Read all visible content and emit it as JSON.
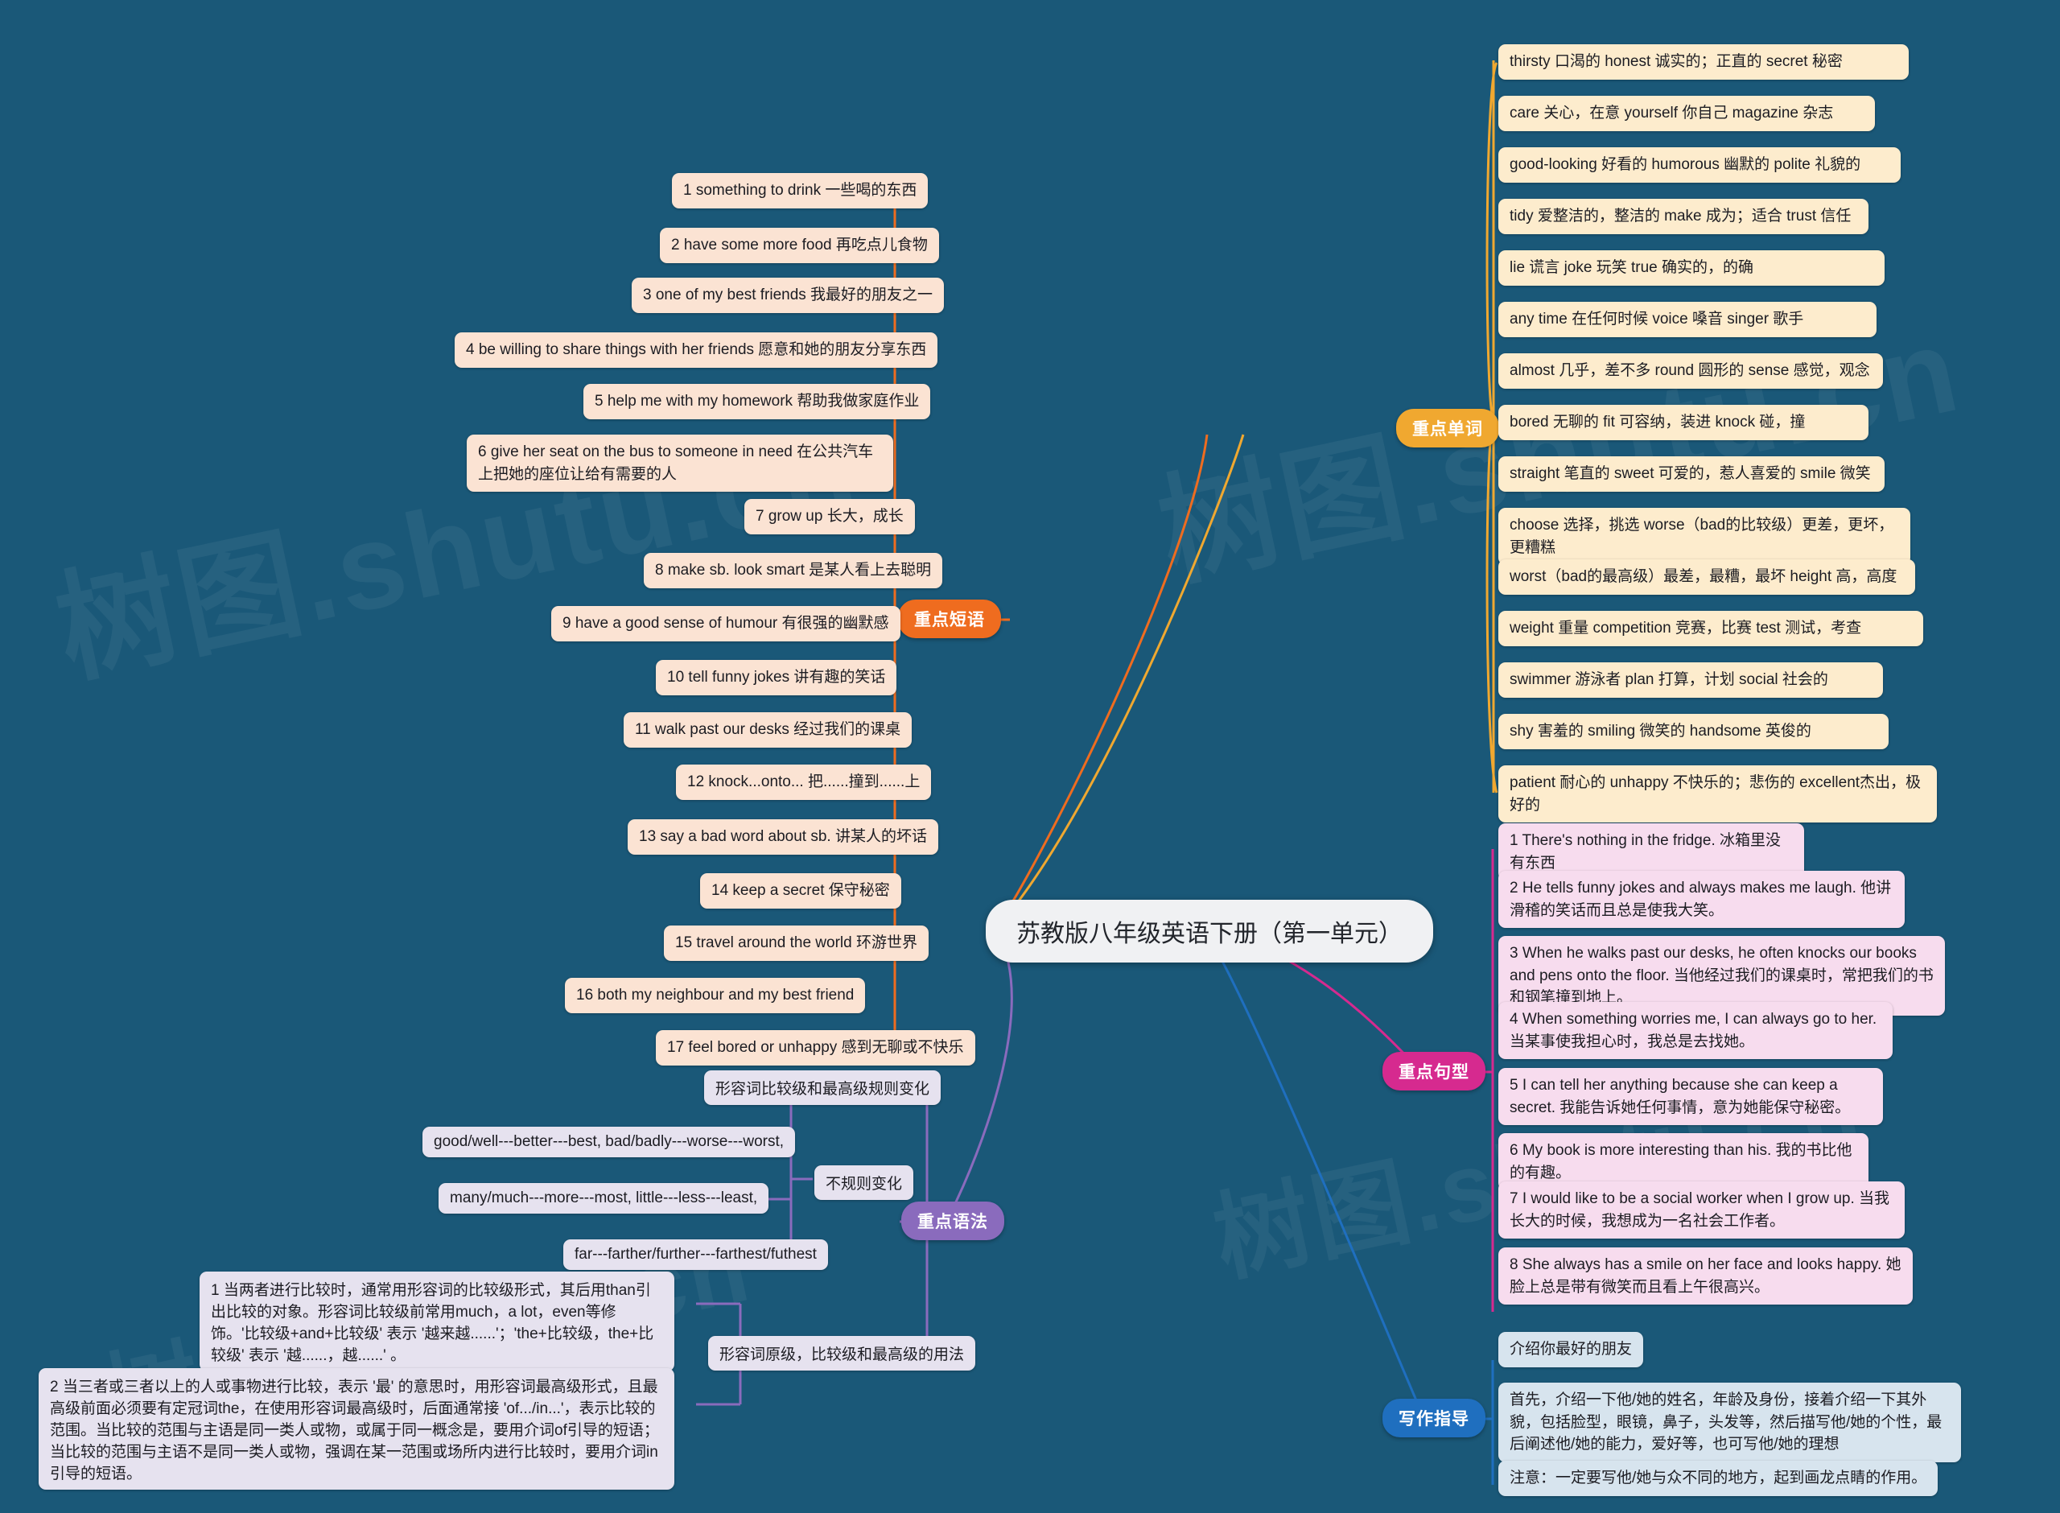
{
  "root": {
    "title": "苏教版八年级英语下册（第一单元）"
  },
  "branches": {
    "phrases": {
      "label": "重点短语",
      "color": "#ef6c1f"
    },
    "words": {
      "label": "重点单词",
      "color": "#f0a830"
    },
    "sentences": {
      "label": "重点句型",
      "color": "#d62a8f"
    },
    "grammar": {
      "label": "重点语法",
      "color": "#8a6bbd"
    },
    "writing": {
      "label": "写作指导",
      "color": "#1f6fbf"
    }
  },
  "phrases": {
    "items": [
      "1 something to drink 一些喝的东西",
      "2 have some more food 再吃点儿食物",
      "3 one of my best friends 我最好的朋友之一",
      "4 be willing to share things with her friends 愿意和她的朋友分享东西",
      "5 help me with my homework 帮助我做家庭作业",
      "6 give her seat on the bus to someone in need 在公共汽车上把她的座位让给有需要的人",
      "7 grow up 长大，成长",
      "8 make sb. look smart 是某人看上去聪明",
      "9 have a good sense of humour 有很强的幽默感",
      "10 tell funny jokes 讲有趣的笑话",
      "11 walk past our desks 经过我们的课桌",
      "12 knock...onto... 把......撞到......上",
      "13 say a bad word about sb. 讲某人的坏话",
      "14 keep a secret 保守秘密",
      "15 travel around the world 环游世界",
      "16 both my neighbour and my best friend",
      "17 feel bored or unhappy 感到无聊或不快乐"
    ]
  },
  "words": {
    "items": [
      "thirsty  口渴的           honest  诚实的；正直的      secret 秘密",
      "care 关心，在意         yourself 你自己                 magazine 杂志",
      "good-looking 好看的     humorous 幽默的              polite 礼貌的",
      "tidy  爱整洁的，整洁的  make 成为；适合          trust 信任",
      "lie 谎言                     joke 玩笑                 true 确实的，的确",
      "any time 在任何时候    voice 嗓音                    singer 歌手",
      "almost 几乎，差不多    round 圆形的                 sense 感觉，观念",
      "bored 无聊的             fit 可容纳，装进            knock 碰，撞",
      "straight 笔直的           sweet 可爱的，惹人喜爱的   smile 微笑",
      "choose 选择，挑选      worse（bad的比较级）更差，更坏，更糟糕",
      "worst（bad的最高级）最差，最糟，最坏           height 高，高度",
      "weight 重量            competition 竞赛，比赛       test 测试，考查",
      "swimmer 游泳者        plan 打算，计划             social 社会的",
      "shy 害羞的                smiling 微笑的                 handsome 英俊的",
      "patient 耐心的           unhappy 不快乐的；悲伤的    excellent杰出，极好的"
    ]
  },
  "sentences": {
    "items": [
      "1 There's nothing in the fridge. 冰箱里没有东西",
      "2 He tells funny jokes and always makes me laugh. 他讲滑稽的笑话而且总是使我大笑。",
      "3 When he walks past our desks, he often knocks our books and pens onto the floor. 当他经过我们的课桌时，常把我们的书和钢笔撞到地上。",
      "4 When something worries me, I can always go to her. 当某事使我担心时，我总是去找她。",
      "5 I can tell her anything because she can keep a secret. 我能告诉她任何事情，意为她能保守秘密。",
      "6 My book is more interesting than his. 我的书比他的有趣。",
      "7 I would like to be a social worker when I grow up. 当我长大的时候，我想成为一名社会工作者。",
      "8 She always has a smile on her face and looks happy. 她脸上总是带有微笑而且看上午很高兴。"
    ]
  },
  "grammar": {
    "topic_rule": "形容词比较级和最高级规则变化",
    "irregular_label": "不规则变化",
    "irregular_items": [
      "good/well---better---best,  bad/badly---worse---worst,",
      "many/much---more---most,              little---less---least,",
      "far---farther/further---farthest/futhest"
    ],
    "usage_label": "形容词原级，比较级和最高级的用法",
    "usage_items": [
      "1 当两者进行比较时，通常用形容词的比较级形式，其后用than引出比较的对象。形容词比较级前常用much，a lot，even等修饰。'比较级+and+比较级' 表示 '越来越......'；'the+比较级，the+比较级' 表示 '越......，越......' 。",
      "2 当三者或三者以上的人或事物进行比较，表示 '最' 的意思时，用形容词最高级形式，且最高级前面必须要有定冠词the，在使用形容词最高级时，后面通常接 'of.../in...'，表示比较的范围。当比较的范围与主语是同一类人或物，或属于同一概念是，要用介词of引导的短语；当比较的范围与主语不是同一类人或物，强调在某一范围或场所内进行比较时，要用介词in引导的短语。"
    ]
  },
  "writing": {
    "items": [
      "介绍你最好的朋友",
      "首先，介绍一下他/她的姓名，年龄及身份，接着介绍一下其外貌，包括脸型，眼镜，鼻子，头发等，然后描写他/她的个性，最后阐述他/她的能力，爱好等，也可写他/她的理想",
      "注意：一定要写他/她与众不同的地方，起到画龙点睛的作用。"
    ]
  },
  "watermarks": [
    "树图.shutu.cn",
    "树图 shutu.cn",
    "树图.shutu.cn"
  ]
}
